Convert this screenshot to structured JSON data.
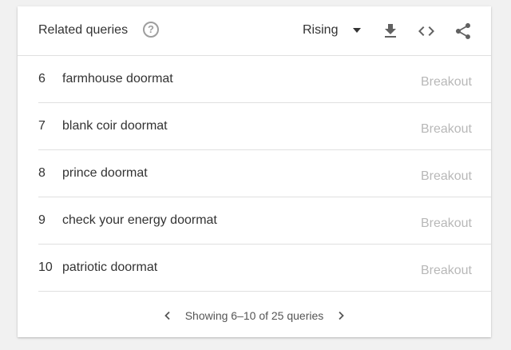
{
  "header": {
    "title": "Related queries",
    "help_icon": "help-circle-icon",
    "dropdown_label": "Rising",
    "icons": [
      "download-icon",
      "embed-code-icon",
      "share-icon"
    ]
  },
  "rows": [
    {
      "index": "6",
      "query": "farmhouse doormat",
      "value": "Breakout"
    },
    {
      "index": "7",
      "query": "blank coir doormat",
      "value": "Breakout"
    },
    {
      "index": "8",
      "query": "prince doormat",
      "value": "Breakout"
    },
    {
      "index": "9",
      "query": "check your energy doormat",
      "value": "Breakout"
    },
    {
      "index": "10",
      "query": "patriotic doormat",
      "value": "Breakout"
    }
  ],
  "footer": {
    "pager_text": "Showing 6–10 of 25 queries"
  },
  "colors": {
    "text": "#333333",
    "muted": "#b8b8b8",
    "icon": "#616161"
  }
}
